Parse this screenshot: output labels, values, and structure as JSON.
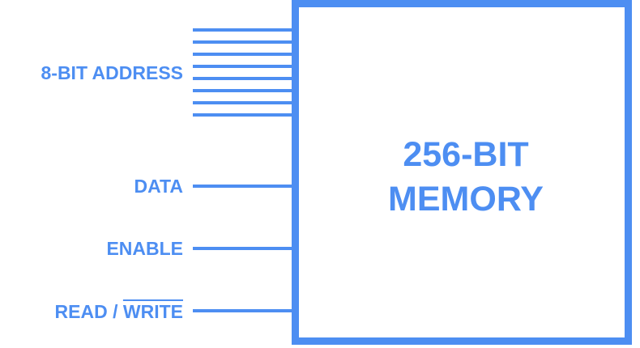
{
  "colors": {
    "accent": "#4d8ef2"
  },
  "memory": {
    "line1": "256-BIT",
    "line2": "MEMORY"
  },
  "pins": {
    "address": {
      "label": "8-BIT ADDRESS",
      "line_count": 8
    },
    "data": {
      "label": "DATA"
    },
    "enable": {
      "label": "ENABLE"
    },
    "read_write": {
      "read_label": "READ / ",
      "write_label": "WRITE"
    }
  }
}
